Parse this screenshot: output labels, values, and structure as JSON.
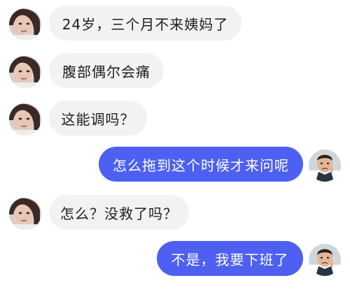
{
  "messages": [
    {
      "side": "left",
      "sender": "patient",
      "text": "24岁，三个月不来姨妈了"
    },
    {
      "side": "left",
      "sender": "patient",
      "text": "腹部偶尔会痛"
    },
    {
      "side": "left",
      "sender": "patient",
      "text": "这能调吗？"
    },
    {
      "side": "right",
      "sender": "doctor",
      "text": "怎么拖到这个时候才来问呢"
    },
    {
      "side": "left",
      "sender": "patient",
      "text": "怎么？没救了吗？"
    },
    {
      "side": "right",
      "sender": "doctor",
      "text": "不是，我要下班了"
    }
  ],
  "colors": {
    "background": "#ffffff",
    "left_bubble": "#f2f2f5",
    "right_bubble": "#4e60f2",
    "left_text": "#1e1e1e",
    "right_text": "#ffffff"
  }
}
